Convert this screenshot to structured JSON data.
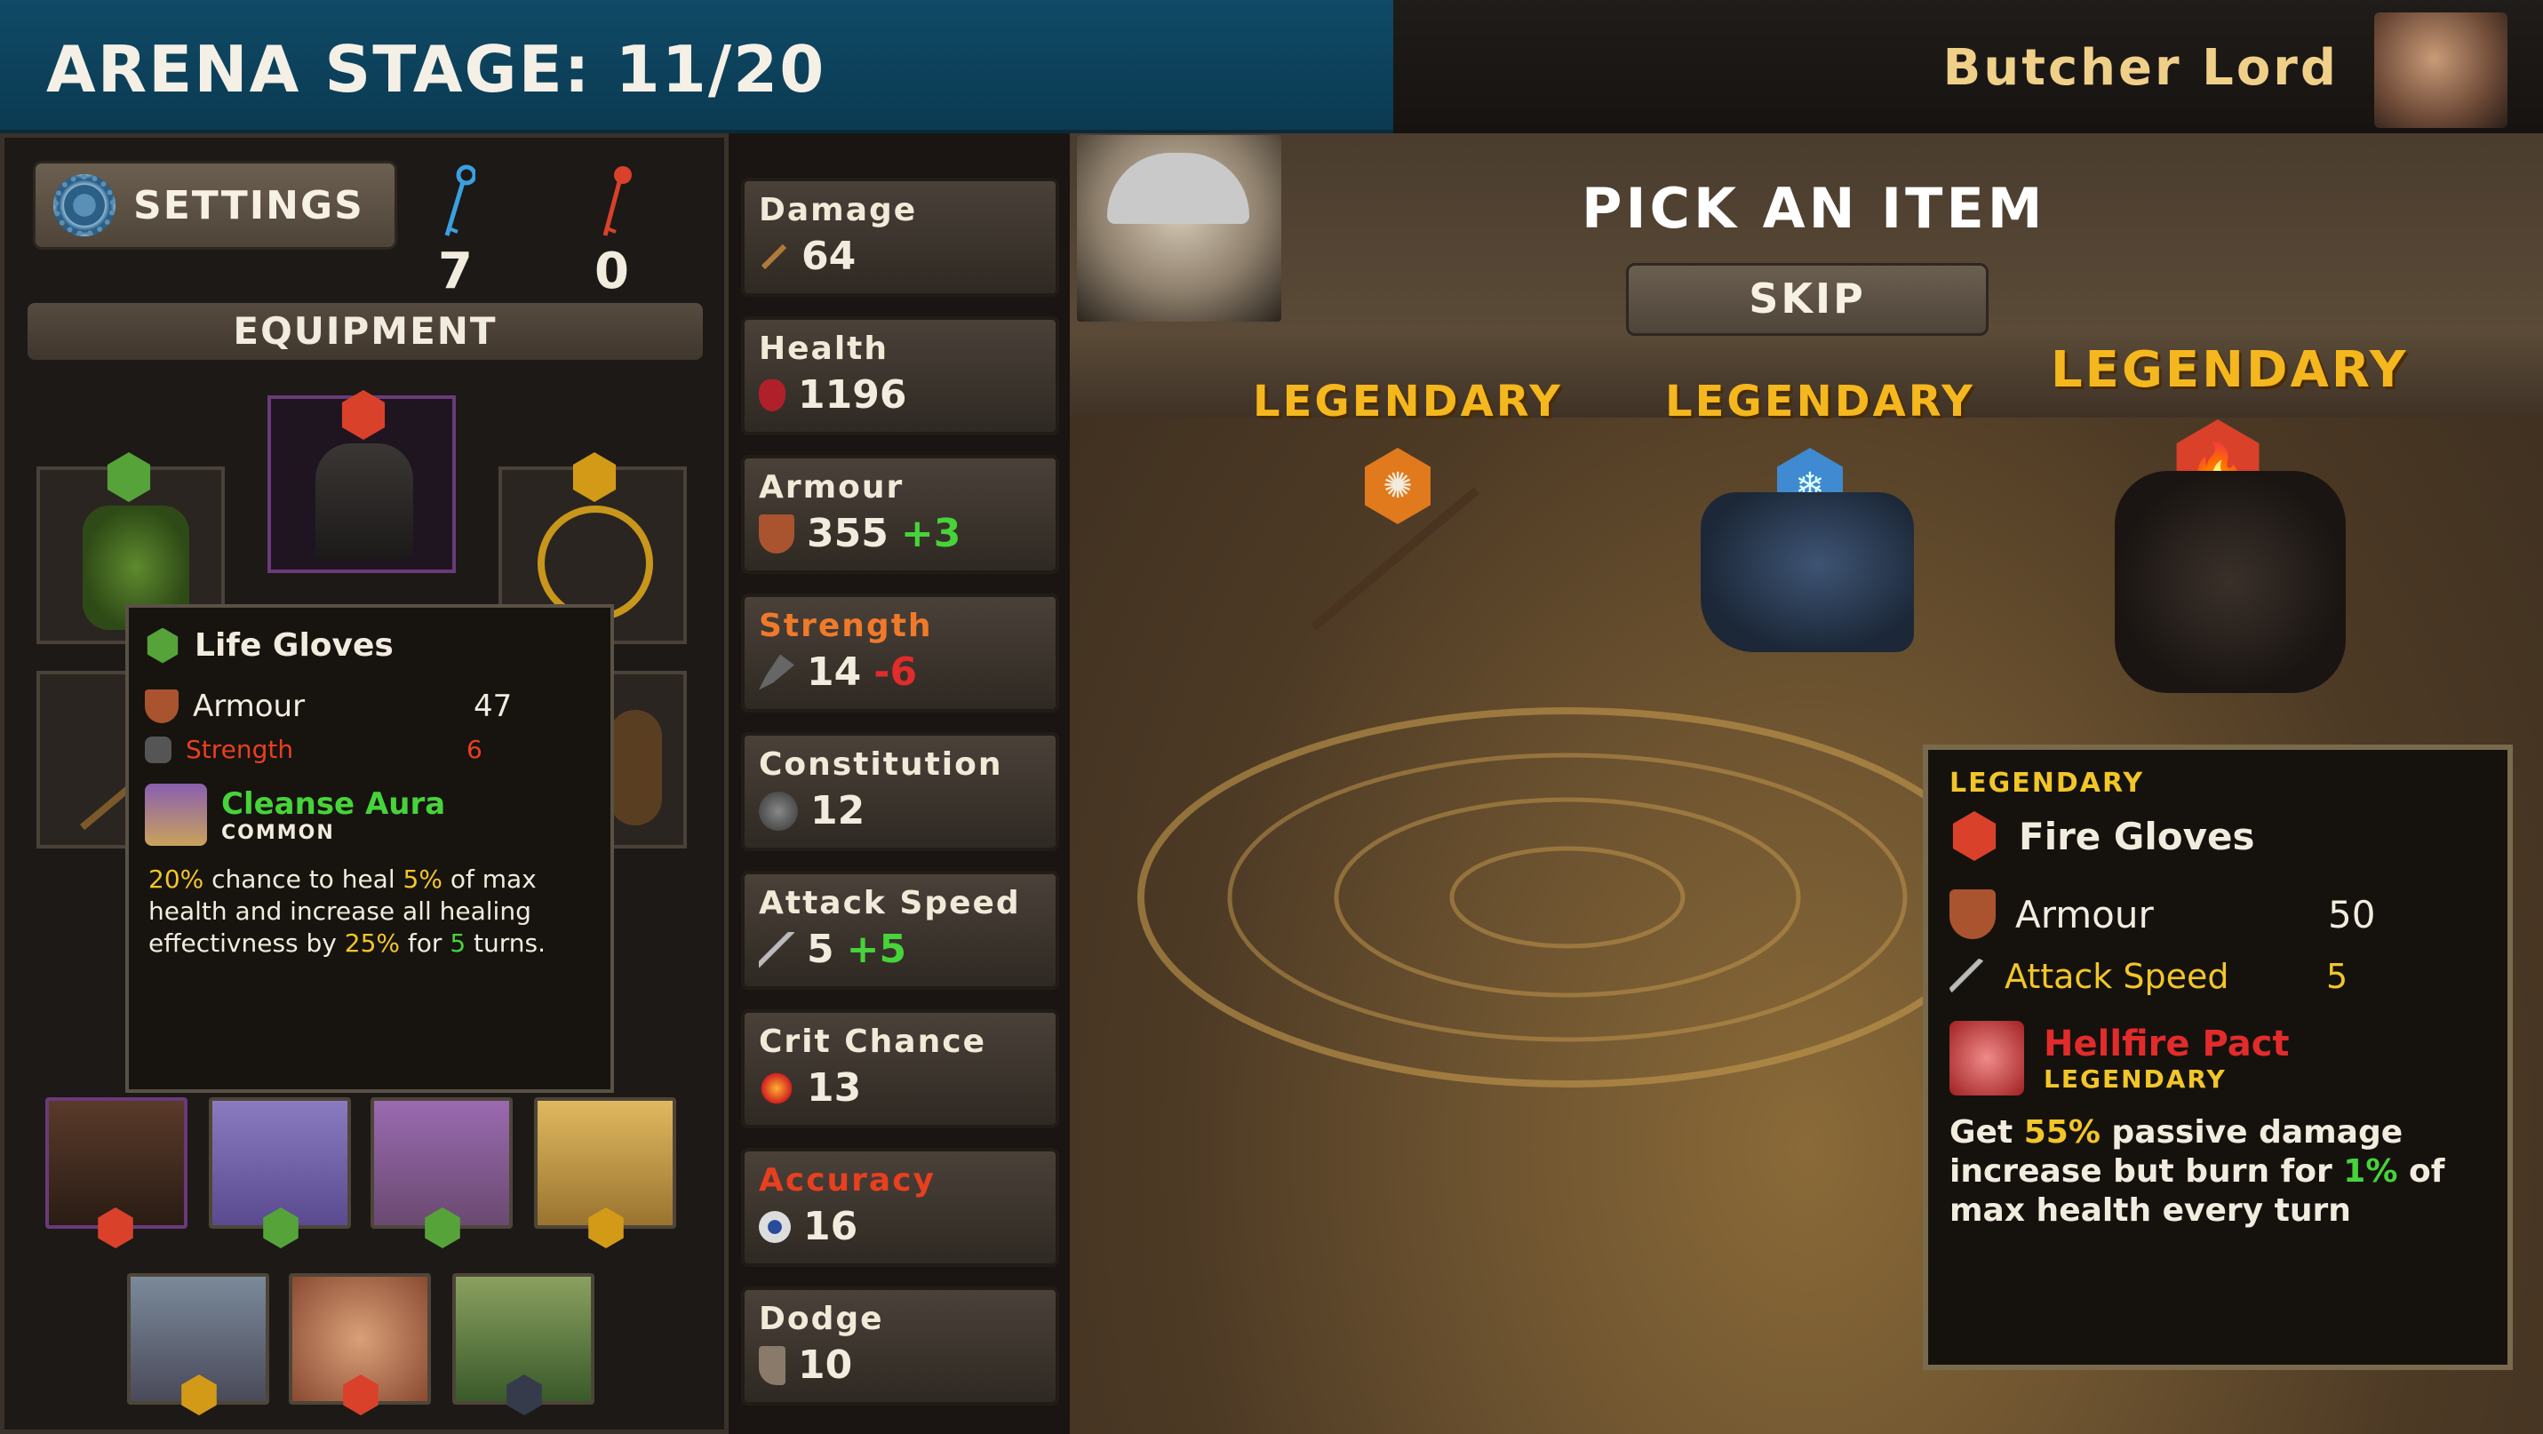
{
  "header": {
    "stage_label": "ARENA STAGE: 11/20",
    "enemy_name": "Butcher Lord"
  },
  "left_panel": {
    "settings_label": "SETTINGS",
    "blue_keys": "7",
    "red_keys": "0",
    "equipment_title": "EQUIPMENT"
  },
  "tooltip_left": {
    "item_name": "Life Gloves",
    "stats": [
      {
        "name": "Armour",
        "value": "47"
      },
      {
        "name": "Strength",
        "value": "6"
      }
    ],
    "ability_name": "Cleanse Aura",
    "ability_rarity": "COMMON",
    "desc_parts": {
      "p1": "20%",
      "p2": " chance to heal ",
      "p3": "5%",
      "p4": " of max health and increase all healing effectivness by ",
      "p5": "25%",
      "p6": " for ",
      "p7": "5",
      "p8": " turns."
    }
  },
  "stats": [
    {
      "label": "Damage",
      "value": "64",
      "bonus": ""
    },
    {
      "label": "Health",
      "value": "1196",
      "bonus": ""
    },
    {
      "label": "Armour",
      "value": "355",
      "bonus": "+3"
    },
    {
      "label": "Strength",
      "value": "14",
      "bonus": "-6"
    },
    {
      "label": "Constitution",
      "value": "12",
      "bonus": ""
    },
    {
      "label": "Attack Speed",
      "value": "5",
      "bonus": "+5"
    },
    {
      "label": "Crit Chance",
      "value": "13",
      "bonus": ""
    },
    {
      "label": "Accuracy",
      "value": "16",
      "bonus": ""
    },
    {
      "label": "Dodge",
      "value": "10",
      "bonus": ""
    }
  ],
  "arena": {
    "pick_title": "PICK AN ITEM",
    "skip_label": "SKIP",
    "items": [
      {
        "rarity": "LEGENDARY",
        "icon": "sun-gem-icon"
      },
      {
        "rarity": "LEGENDARY",
        "icon": "snowflake-gem-icon"
      },
      {
        "rarity": "LEGENDARY",
        "icon": "fire-gem-icon"
      }
    ]
  },
  "fire_card": {
    "rarity": "LEGENDARY",
    "name": "Fire Gloves",
    "stats": [
      {
        "name": "Armour",
        "value": "50"
      },
      {
        "name": "Attack Speed",
        "value": "5"
      }
    ],
    "ability_name": "Hellfire Pact",
    "ability_rarity": "LEGENDARY",
    "desc_parts": {
      "p1": "Get ",
      "p2": "55%",
      "p3": " passive damage increase but burn for ",
      "p4": "1%",
      "p5": " of max health every turn"
    }
  },
  "colors": {
    "accent_gold": "#f5b71e",
    "bonus_green": "#47d33a",
    "penalty_red": "#e22b2b",
    "stage_blue": "#0f4a66"
  }
}
